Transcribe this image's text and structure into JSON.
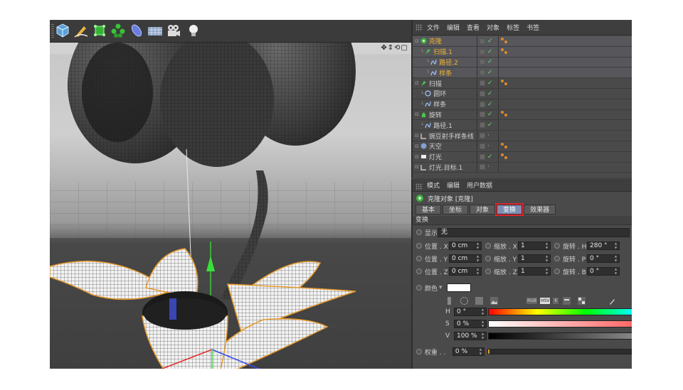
{
  "toolbar": {
    "tools": [
      {
        "name": "cube-icon",
        "color": "#7fb7e8"
      },
      {
        "name": "pen-icon",
        "color": "#e8b440"
      },
      {
        "name": "subdivide-icon",
        "color": "#4fd04f"
      },
      {
        "name": "array-icon",
        "color": "#4fd04f"
      },
      {
        "name": "deformer-icon",
        "color": "#6a7ee0"
      },
      {
        "name": "floor-icon",
        "color": "#8fa6c8"
      },
      {
        "name": "camera-icon",
        "color": "#dddddd"
      },
      {
        "name": "light-icon",
        "color": "#eeeeee"
      }
    ]
  },
  "viewport": {
    "nav_icons": "✥⇕⟲▢"
  },
  "object_manager": {
    "menu": [
      "文件",
      "编辑",
      "查看",
      "对象",
      "标签",
      "书签"
    ],
    "objects": [
      {
        "label": "克隆",
        "indent": 0,
        "icon": "cloner-icon",
        "highlight": true,
        "check": true,
        "tag": true,
        "selected": true
      },
      {
        "label": "扫描.1",
        "indent": 1,
        "icon": "sweep-icon",
        "highlight": true,
        "check": true,
        "tag": true,
        "selected": true
      },
      {
        "label": "路径.2",
        "indent": 2,
        "icon": "spline-icon",
        "highlight": true,
        "check": true,
        "tag": false,
        "selected": true
      },
      {
        "label": "样条",
        "indent": 2,
        "icon": "spline-icon",
        "highlight": true,
        "check": true,
        "tag": false,
        "selected": true
      },
      {
        "label": "扫描",
        "indent": 0,
        "icon": "sweep-icon",
        "highlight": false,
        "check": true,
        "tag": true,
        "selected": false
      },
      {
        "label": "圆环",
        "indent": 1,
        "icon": "circle-icon",
        "highlight": false,
        "check": true,
        "tag": false,
        "selected": false
      },
      {
        "label": "样条",
        "indent": 1,
        "icon": "spline-icon",
        "highlight": false,
        "check": true,
        "tag": false,
        "selected": false
      },
      {
        "label": "旋转",
        "indent": 0,
        "icon": "lathe-icon",
        "highlight": false,
        "check": true,
        "tag": true,
        "selected": false
      },
      {
        "label": "路径.1",
        "indent": 1,
        "icon": "spline-icon",
        "highlight": false,
        "check": true,
        "tag": false,
        "selected": false
      },
      {
        "label": "豌豆射手样条线",
        "indent": 0,
        "icon": "null-icon",
        "highlight": false,
        "check": false,
        "tag": false,
        "selected": false
      },
      {
        "label": "天空",
        "indent": 0,
        "icon": "sky-icon",
        "highlight": false,
        "check": false,
        "tag": true,
        "selected": false
      },
      {
        "label": "灯光",
        "indent": 0,
        "icon": "light-obj-icon",
        "highlight": false,
        "check": true,
        "tag": true,
        "selected": false
      },
      {
        "label": "灯光.目标.1",
        "indent": 0,
        "icon": "null-icon",
        "highlight": false,
        "check": false,
        "tag": false,
        "selected": false
      }
    ]
  },
  "attribute_manager": {
    "menu": [
      "模式",
      "编辑",
      "用户数据"
    ],
    "title": "克隆对象 [克隆]",
    "tabs": [
      "基本",
      "坐标",
      "对象",
      "变换",
      "效果器"
    ],
    "active_tab": "变换",
    "section": "变换",
    "display_label": "显示",
    "display_value": "无",
    "transform": [
      {
        "pos_label": "位置 . X",
        "pos": "0 cm",
        "scale_label": "缩放 . X",
        "scale": "1",
        "rot_label": "旋转 . H",
        "rot": "280 °"
      },
      {
        "pos_label": "位置 . Y",
        "pos": "0 cm",
        "scale_label": "缩放 . Y",
        "scale": "1",
        "rot_label": "旋转 . P",
        "rot": "0 °"
      },
      {
        "pos_label": "位置 . Z",
        "pos": "0 cm",
        "scale_label": "缩放 . Z",
        "scale": "1",
        "rot_label": "旋转 . B",
        "rot": "0 °"
      }
    ],
    "color_label": "颜色",
    "color_value": "#ffffff",
    "color_modes": [
      "RGB",
      "HSV",
      "K"
    ],
    "hsv": [
      {
        "label": "H",
        "value": "0 °"
      },
      {
        "label": "S",
        "value": "0 %"
      },
      {
        "label": "V",
        "value": "100 %"
      }
    ],
    "weight_label": "权重 . .",
    "weight_value": "0 %"
  }
}
